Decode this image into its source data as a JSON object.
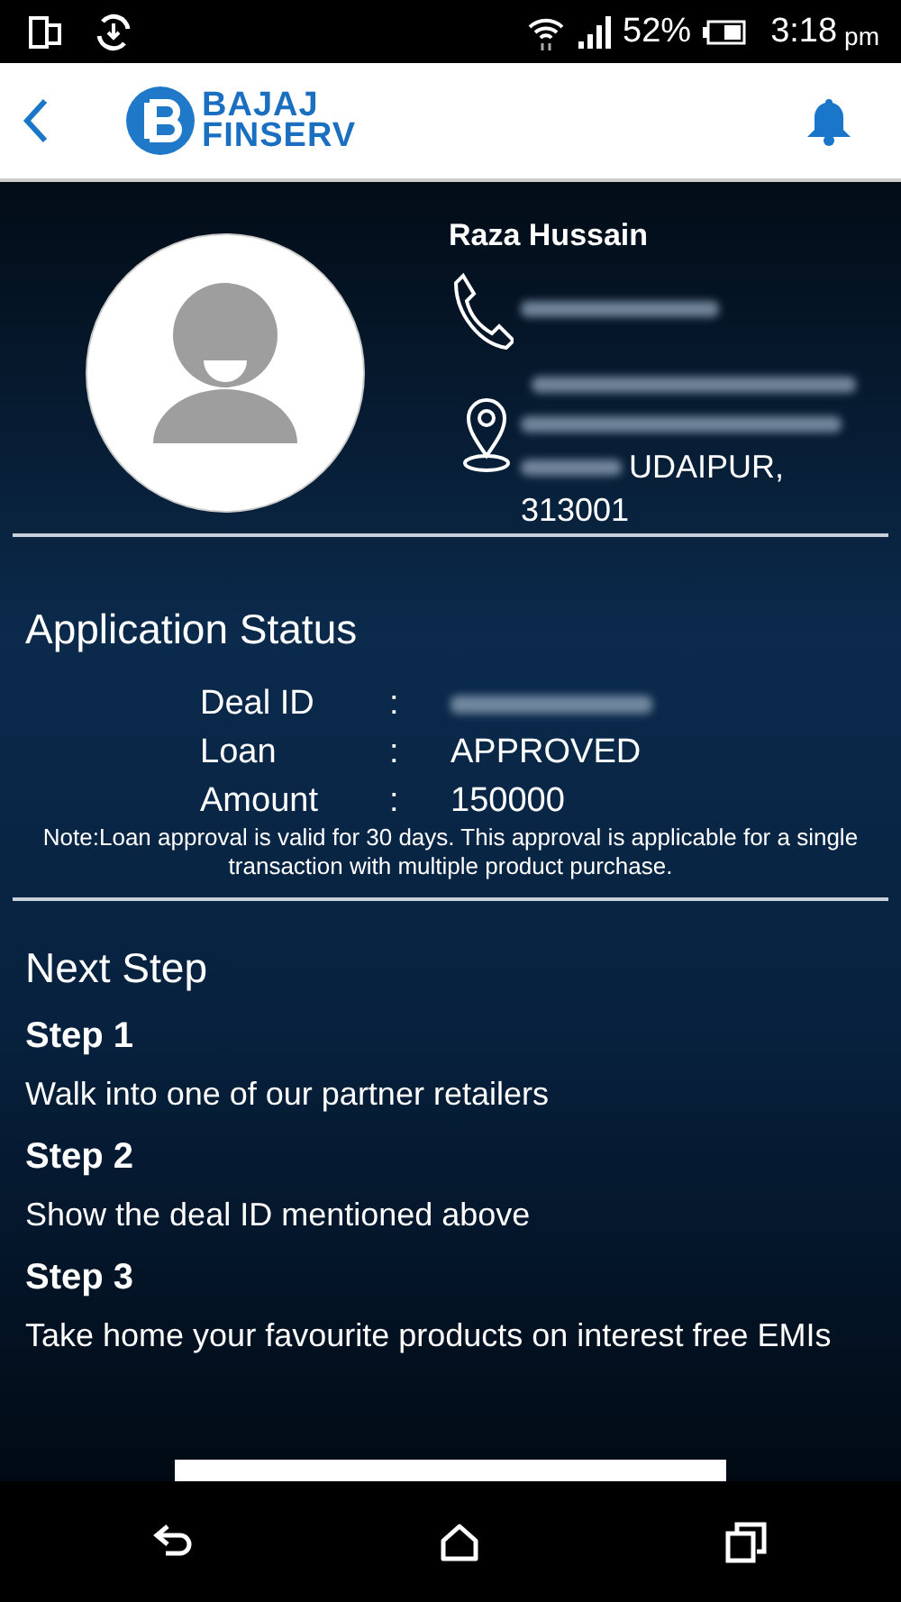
{
  "status_bar": {
    "battery": "52%",
    "time": "3:18",
    "period": "pm"
  },
  "header": {
    "logo": [
      "BAJAJ",
      "FINSERV"
    ]
  },
  "profile": {
    "name": "Raza Hussain",
    "city": "UDAIPUR,",
    "postcode": "313001"
  },
  "application_status": {
    "title": "Application Status",
    "rows": [
      {
        "kind": "blurred",
        "label": "Deal ID",
        "separator": ":"
      },
      {
        "kind": "text",
        "label": "Loan",
        "separator": ":",
        "value": "APPROVED"
      },
      {
        "kind": "text",
        "label": "Amount",
        "separator": ":",
        "value": "150000"
      }
    ],
    "note": "Note:Loan approval is valid for 30 days. This approval is applicable for a single transaction with multiple product purchase."
  },
  "next_step": {
    "title": "Next Step",
    "steps": [
      {
        "title": "Step 1",
        "text": "Walk into one of our partner retailers"
      },
      {
        "title": "Step 2",
        "text": "Show the deal ID mentioned above"
      },
      {
        "title": "Step 3",
        "text": "Take home your favourite products on interest free EMIs"
      }
    ]
  }
}
